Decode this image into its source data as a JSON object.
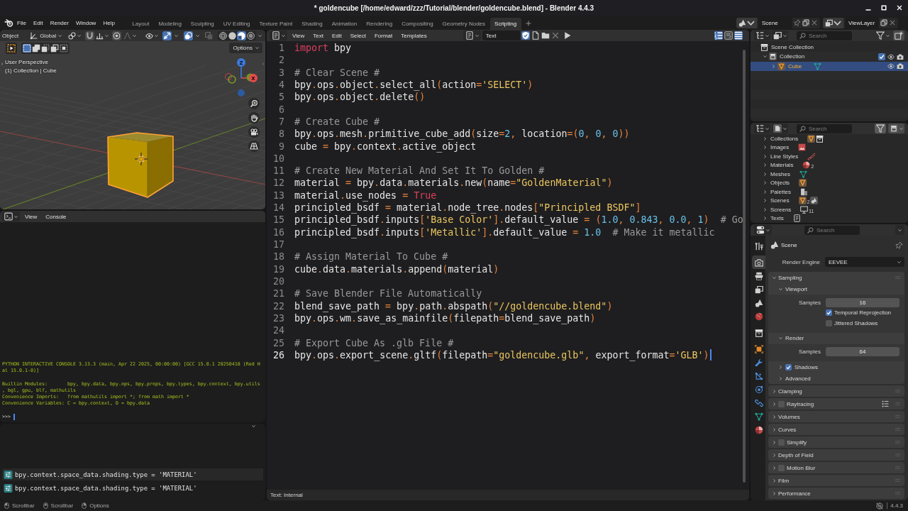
{
  "window": {
    "title": "* goldencube [/home/edward/zzz/Tutorial/blender/goldencube.blend] - Blender 4.4.3"
  },
  "menu": [
    "File",
    "Edit",
    "Render",
    "Window",
    "Help"
  ],
  "workspaces": [
    {
      "label": "Layout",
      "selected": false
    },
    {
      "label": "Modeling",
      "selected": false
    },
    {
      "label": "Sculpting",
      "selected": false
    },
    {
      "label": "UV Editing",
      "selected": false
    },
    {
      "label": "Texture Paint",
      "selected": false
    },
    {
      "label": "Shading",
      "selected": false
    },
    {
      "label": "Animation",
      "selected": false
    },
    {
      "label": "Rendering",
      "selected": false
    },
    {
      "label": "Compositing",
      "selected": false
    },
    {
      "label": "Geometry Nodes",
      "selected": false
    },
    {
      "label": "Scripting",
      "selected": true
    }
  ],
  "scene_selector": {
    "scene": "Scene",
    "view_layer": "ViewLayer"
  },
  "viewport": {
    "mode": "Object",
    "orientation": "Global",
    "toggles": [
      {
        "kind": "gizmos",
        "on": true
      },
      {
        "kind": "overlays",
        "on": true
      },
      {
        "kind": "xray",
        "on": false
      }
    ],
    "shading": [
      {
        "kind": "wireframe",
        "selected": false
      },
      {
        "kind": "solid",
        "selected": false
      },
      {
        "kind": "material",
        "selected": true
      },
      {
        "kind": "rendered",
        "selected": false
      }
    ],
    "select_modes": [
      {
        "kind": "set",
        "selected": true
      },
      {
        "kind": "extend",
        "selected": false
      },
      {
        "kind": "subtract",
        "selected": false
      },
      {
        "kind": "invert",
        "selected": false
      },
      {
        "kind": "intersect",
        "selected": false
      }
    ],
    "options": "Options",
    "overlay_text": [
      "User Perspective",
      "(1) Collection | Cube"
    ],
    "axis_labels": [
      "Z",
      "X"
    ]
  },
  "console": {
    "menu": [
      "View",
      "Console"
    ],
    "blocks": [
      [
        "PYTHON INTERACTIVE CONSOLE 3.13.3 (main, Apr 22 2025, 00:00:00) [GCC 15.0.1 20250418 (Red H",
        "at 15.0.1-0)]"
      ],
      [
        "Builtin Modules:       bpy, bpy.data, bpy.ops, bpy.props, bpy.types, bpy.context, bpy.utils",
        ", bgl, gpu, blf, mathutils",
        "Convenience Imports:   from mathutils import *; from math import *",
        "Convenience Variables: C = bpy.context, D = bpy.data"
      ]
    ],
    "prompt": ">>>"
  },
  "info": {
    "reports": [
      "bpy.context.space_data.shading.type = 'MATERIAL'",
      "bpy.context.space_data.shading.type = 'MATERIAL'"
    ]
  },
  "text_editor": {
    "menu": [
      "View",
      "Text",
      "Edit",
      "Select",
      "Format",
      "Templates"
    ],
    "datablock": "Text",
    "fake_user": true,
    "view_toggles": [
      {
        "kind": "line_numbers",
        "on": true
      },
      {
        "kind": "word_wrap",
        "on": false
      },
      {
        "kind": "syntax_highlight",
        "on": true
      }
    ],
    "lines": [
      {
        "number": "1",
        "current": false,
        "segments": [
          {
            "kind": "keyword",
            "text": "import"
          },
          {
            "kind": "plain",
            "text": " bpy"
          }
        ]
      },
      {
        "number": "2",
        "current": false
      },
      {
        "number": "3",
        "current": false,
        "segments": [
          {
            "kind": "comment",
            "text": "# Clear Scene #"
          }
        ]
      },
      {
        "number": "4",
        "current": false,
        "segments": [
          {
            "kind": "plain",
            "text": "bpy.ops.object.select_all(action="
          },
          {
            "kind": "string",
            "text": "'SELECT'"
          },
          {
            "kind": "plain",
            "text": ")"
          }
        ]
      },
      {
        "number": "5",
        "current": false,
        "segments": [
          {
            "kind": "plain",
            "text": "bpy.ops.object.delete()"
          }
        ]
      },
      {
        "number": "6",
        "current": false
      },
      {
        "number": "7",
        "current": false,
        "segments": [
          {
            "kind": "comment",
            "text": "# Create Cube #"
          }
        ]
      },
      {
        "number": "8",
        "current": false,
        "segments": [
          {
            "kind": "plain",
            "text": "bpy.ops.mesh.primitive_cube_add(size="
          },
          {
            "kind": "number",
            "text": "2"
          },
          {
            "kind": "plain",
            "text": ", location=("
          },
          {
            "kind": "number",
            "text": "0"
          },
          {
            "kind": "plain",
            "text": ", "
          },
          {
            "kind": "number",
            "text": "0"
          },
          {
            "kind": "plain",
            "text": ", "
          },
          {
            "kind": "number",
            "text": "0"
          },
          {
            "kind": "plain",
            "text": "))"
          }
        ]
      },
      {
        "number": "9",
        "current": false,
        "segments": [
          {
            "kind": "plain",
            "text": "cube = bpy.context.active_object"
          }
        ]
      },
      {
        "number": "10",
        "current": false
      },
      {
        "number": "11",
        "current": false,
        "segments": [
          {
            "kind": "comment",
            "text": "# Create New Material And Set It To Golden #"
          }
        ]
      },
      {
        "number": "12",
        "current": false,
        "segments": [
          {
            "kind": "plain",
            "text": "material = bpy.data.materials.new(name="
          },
          {
            "kind": "string",
            "text": "\"GoldenMaterial\""
          },
          {
            "kind": "plain",
            "text": ")"
          }
        ]
      },
      {
        "number": "13",
        "current": false,
        "segments": [
          {
            "kind": "plain",
            "text": "material.use_nodes = "
          },
          {
            "kind": "keyword",
            "text": "True"
          }
        ]
      },
      {
        "number": "14",
        "current": false,
        "segments": [
          {
            "kind": "plain",
            "text": "principled_bsdf = material.node_tree.nodes["
          },
          {
            "kind": "string",
            "text": "\"Principled BSDF\""
          },
          {
            "kind": "plain",
            "text": "]"
          }
        ]
      },
      {
        "number": "15",
        "current": false,
        "segments": [
          {
            "kind": "plain",
            "text": "principled_bsdf.inputs["
          },
          {
            "kind": "string",
            "text": "'Base Color'"
          },
          {
            "kind": "plain",
            "text": "].default_value = ("
          },
          {
            "kind": "number",
            "text": "1.0"
          },
          {
            "kind": "plain",
            "text": ", "
          },
          {
            "kind": "number",
            "text": "0.843"
          },
          {
            "kind": "plain",
            "text": ", "
          },
          {
            "kind": "number",
            "text": "0.0"
          },
          {
            "kind": "plain",
            "text": ", "
          },
          {
            "kind": "number",
            "text": "1"
          },
          {
            "kind": "plain",
            "text": ")  "
          },
          {
            "kind": "comment",
            "text": "# Go"
          }
        ]
      },
      {
        "number": "16",
        "current": false,
        "segments": [
          {
            "kind": "plain",
            "text": "principled_bsdf.inputs["
          },
          {
            "kind": "string",
            "text": "'Metallic'"
          },
          {
            "kind": "plain",
            "text": "].default_value = "
          },
          {
            "kind": "number",
            "text": "1.0"
          },
          {
            "kind": "comment",
            "text": "  # Make it metallic"
          }
        ]
      },
      {
        "number": "17",
        "current": false
      },
      {
        "number": "18",
        "current": false,
        "segments": [
          {
            "kind": "comment",
            "text": "# Assign Material To Cube #"
          }
        ]
      },
      {
        "number": "19",
        "current": false,
        "segments": [
          {
            "kind": "plain",
            "text": "cube.data.materials.append(material)"
          }
        ]
      },
      {
        "number": "20",
        "current": false
      },
      {
        "number": "21",
        "current": false,
        "segments": [
          {
            "kind": "comment",
            "text": "# Save Blender File Automatically"
          }
        ]
      },
      {
        "number": "22",
        "current": false,
        "segments": [
          {
            "kind": "plain",
            "text": "blend_save_path = bpy.path.abspath("
          },
          {
            "kind": "string",
            "text": "\"//goldencube.blend\""
          },
          {
            "kind": "plain",
            "text": ")"
          }
        ]
      },
      {
        "number": "23",
        "current": false,
        "segments": [
          {
            "kind": "plain",
            "text": "bpy.ops.wm.save_as_mainfile(filepath=blend_save_path)"
          }
        ]
      },
      {
        "number": "24",
        "current": false
      },
      {
        "number": "25",
        "current": false,
        "segments": [
          {
            "kind": "comment",
            "text": "# Export Cube As .glb File #"
          }
        ]
      },
      {
        "number": "26",
        "current": true,
        "segments": [
          {
            "kind": "plain",
            "text": "bpy.ops.export_scene.gltf(filepath="
          },
          {
            "kind": "string",
            "text": "\"goldencube.glb\""
          },
          {
            "kind": "plain",
            "text": ", export_format="
          },
          {
            "kind": "string",
            "text": "'GLB'"
          },
          {
            "kind": "plain",
            "text": ")"
          }
        ]
      }
    ],
    "footer": "Text: Internal"
  },
  "outliner": {
    "search": {
      "placeholder": "Search"
    },
    "tree": [
      {
        "kind": "scene_collection",
        "label": "Scene Collection",
        "selected": false,
        "children": [
          {
            "kind": "collection",
            "label": "Collection",
            "selected": false,
            "expanded": true,
            "checked": true,
            "children": [
              {
                "kind": "object",
                "label": "Cube",
                "selected": true,
                "expanded": false
              }
            ]
          }
        ]
      }
    ]
  },
  "blend_file": {
    "search": {
      "placeholder": "Search"
    },
    "rows": [
      {
        "kind": "collections",
        "label": "Collections",
        "expanded": false
      },
      {
        "kind": "images",
        "label": "Images",
        "expanded": false
      },
      {
        "kind": "line_styles",
        "label": "Line Styles",
        "expanded": false
      },
      {
        "kind": "materials",
        "label": "Materials",
        "expanded": false,
        "count": "2"
      },
      {
        "kind": "meshes",
        "label": "Meshes",
        "expanded": false
      },
      {
        "kind": "objects",
        "label": "Objects",
        "expanded": false
      },
      {
        "kind": "palettes",
        "label": "Palettes",
        "expanded": false
      },
      {
        "kind": "scenes",
        "label": "Scenes",
        "expanded": false,
        "count": "2"
      },
      {
        "kind": "screens",
        "label": "Screens",
        "expanded": false,
        "count": "11"
      },
      {
        "kind": "texts",
        "label": "Texts",
        "expanded": false
      }
    ]
  },
  "properties": {
    "search": {
      "placeholder": "Search"
    },
    "tab_groups": [
      [
        {
          "kind": "tool",
          "selected": false
        }
      ],
      [
        {
          "kind": "render",
          "selected": true
        },
        {
          "kind": "output",
          "selected": false
        },
        {
          "kind": "view_layer",
          "selected": false
        },
        {
          "kind": "scene",
          "selected": false
        },
        {
          "kind": "world",
          "selected": false
        }
      ],
      [
        {
          "kind": "collection",
          "selected": false
        }
      ],
      [
        {
          "kind": "object",
          "selected": false
        },
        {
          "kind": "modifiers",
          "selected": false
        },
        {
          "kind": "particles",
          "selected": false
        },
        {
          "kind": "physics",
          "selected": false
        },
        {
          "kind": "constraints",
          "selected": false
        },
        {
          "kind": "data",
          "selected": false
        },
        {
          "kind": "material",
          "selected": false
        }
      ]
    ],
    "context": "Scene",
    "render_engine": {
      "label": "Render Engine",
      "value": "EEVEE"
    },
    "panels": [
      {
        "kind": "plain",
        "label": "Sampling",
        "expanded": true,
        "children": [
          {
            "kind": "plain",
            "label": "Viewport",
            "expanded": true,
            "fields": [
              {
                "kind": "number",
                "label": "Samples",
                "value": "16"
              },
              {
                "kind": "checkbox",
                "label": "Temporal Reprojection",
                "checked": true
              },
              {
                "kind": "checkbox",
                "label": "Jittered Shadows",
                "checked": false
              }
            ]
          },
          {
            "kind": "plain",
            "label": "Render",
            "expanded": true,
            "fields": [
              {
                "kind": "number",
                "label": "Samples",
                "value": "64"
              }
            ]
          },
          {
            "kind": "toggle",
            "label": "Shadows",
            "checked": true,
            "expanded": false
          },
          {
            "kind": "plain",
            "label": "Advanced",
            "expanded": false
          }
        ]
      },
      {
        "kind": "plain",
        "label": "Clamping",
        "expanded": false
      },
      {
        "kind": "toggle",
        "label": "Raytracing",
        "checked": false,
        "expanded": false,
        "presets": true
      },
      {
        "kind": "plain",
        "label": "Volumes",
        "expanded": false
      },
      {
        "kind": "plain",
        "label": "Curves",
        "expanded": false
      },
      {
        "kind": "toggle",
        "label": "Simplify",
        "checked": false,
        "expanded": false
      },
      {
        "kind": "plain",
        "label": "Depth of Field",
        "expanded": false
      },
      {
        "kind": "toggle",
        "label": "Motion Blur",
        "checked": false,
        "expanded": false
      },
      {
        "kind": "plain",
        "label": "Film",
        "expanded": false
      },
      {
        "kind": "plain",
        "label": "Performance",
        "expanded": false
      }
    ]
  },
  "status_bar": {
    "hints": [
      {
        "kind": "left",
        "label": "Scrollbar"
      },
      {
        "kind": "middle",
        "label": "Scrollbar"
      },
      {
        "kind": "right",
        "label": "Options"
      }
    ],
    "version": "4.4.3"
  }
}
